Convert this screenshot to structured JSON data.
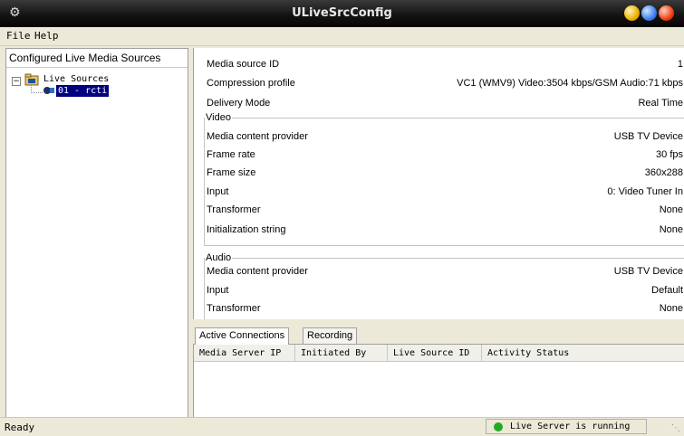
{
  "window": {
    "title": "ULiveSrcConfig"
  },
  "menu": {
    "file": "File",
    "help": "Help"
  },
  "tree": {
    "header": "Configured Live Media Sources",
    "root_label": "Live Sources",
    "child_label": "01 - rcti"
  },
  "details": {
    "media_source_id": {
      "label": "Media source ID",
      "value": "1"
    },
    "compression_profile": {
      "label": "Compression profile",
      "value": "VC1 (WMV9) Video:3504 kbps/GSM Audio:71 kbps"
    },
    "delivery_mode": {
      "label": "Delivery Mode",
      "value": "Real Time"
    },
    "video": {
      "title": "Video",
      "provider": {
        "label": "Media content provider",
        "value": "USB TV Device"
      },
      "frame_rate": {
        "label": "Frame rate",
        "value": "30 fps"
      },
      "frame_size": {
        "label": "Frame size",
        "value": "360x288"
      },
      "input": {
        "label": "Input",
        "value": "0: Video Tuner In"
      },
      "transformer": {
        "label": "Transformer",
        "value": "None"
      },
      "init_string": {
        "label": "Initialization string",
        "value": "None"
      }
    },
    "audio": {
      "title": "Audio",
      "provider": {
        "label": "Media content provider",
        "value": "USB TV Device"
      },
      "input": {
        "label": "Input",
        "value": "Default"
      },
      "transformer": {
        "label": "Transformer",
        "value": "None"
      }
    }
  },
  "tabs": {
    "active_connections": "Active Connections",
    "recording": "Recording"
  },
  "grid": {
    "columns": [
      "Media Server IP",
      "Initiated By",
      "Live Source ID",
      "Activity Status"
    ]
  },
  "status": {
    "left": "Ready",
    "right": "Live Server is running",
    "indicator_color": "#22aa22"
  }
}
